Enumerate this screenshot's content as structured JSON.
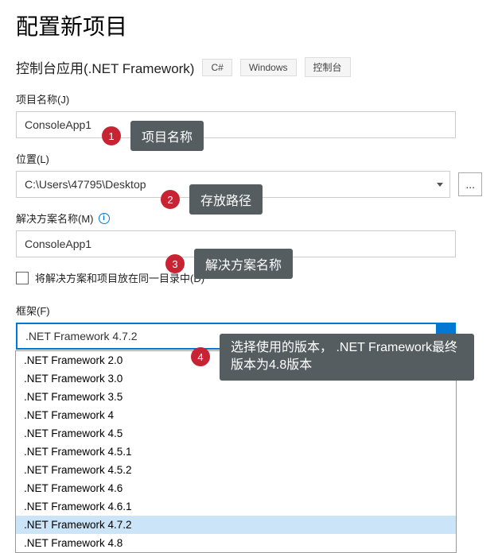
{
  "header": {
    "title": "配置新项目",
    "project_type": "控制台应用(.NET Framework)",
    "tags": {
      "t1": "C#",
      "t2": "Windows",
      "t3": "控制台"
    }
  },
  "fields": {
    "project_name": {
      "label": "项目名称(J)",
      "value": "ConsoleApp1"
    },
    "location": {
      "label": "位置(L)",
      "value": "C:\\Users\\47795\\Desktop",
      "browse": "..."
    },
    "solution_name": {
      "label": "解决方案名称(M)",
      "value": "ConsoleApp1"
    },
    "same_dir": {
      "label": "将解决方案和项目放在同一目录中(D)"
    },
    "framework": {
      "label": "框架(F)",
      "value": ".NET Framework 4.7.2"
    }
  },
  "framework_options": {
    "o0": ".NET Framework 2.0",
    "o1": ".NET Framework 3.0",
    "o2": ".NET Framework 3.5",
    "o3": ".NET Framework 4",
    "o4": ".NET Framework 4.5",
    "o5": ".NET Framework 4.5.1",
    "o6": ".NET Framework 4.5.2",
    "o7": ".NET Framework 4.6",
    "o8": ".NET Framework 4.6.1",
    "o9": ".NET Framework 4.7.2",
    "o10": ".NET Framework 4.8"
  },
  "callouts": {
    "c1": {
      "num": "1",
      "text": "项目名称"
    },
    "c2": {
      "num": "2",
      "text": "存放路径"
    },
    "c3": {
      "num": "3",
      "text": "解决方案名称"
    },
    "c4": {
      "num": "4",
      "text": "选择使用的版本， .NET Framework最终版本为4.8版本"
    }
  }
}
